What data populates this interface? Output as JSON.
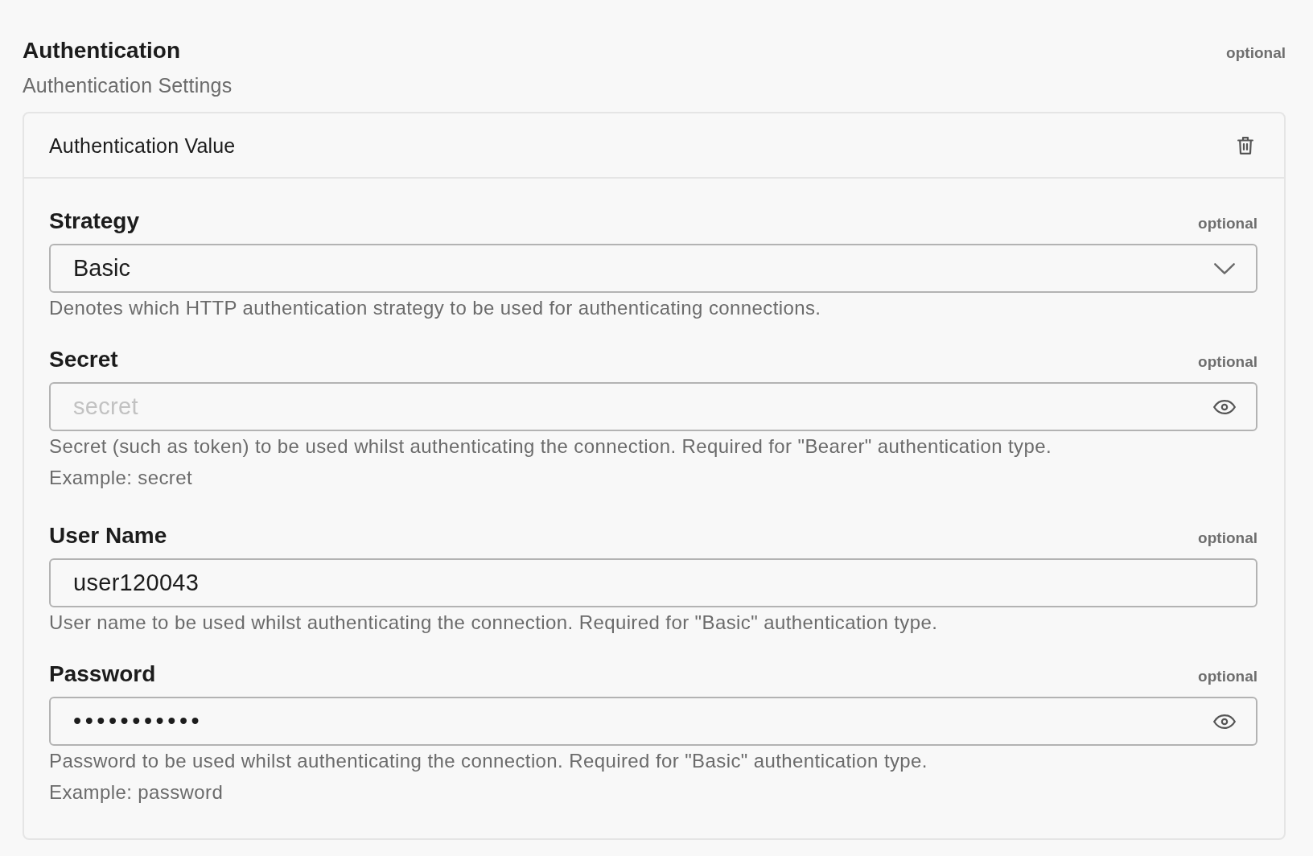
{
  "section": {
    "title": "Authentication",
    "badge": "optional",
    "subtitle": "Authentication Settings"
  },
  "card": {
    "title": "Authentication Value",
    "fields": [
      {
        "kind": "select",
        "label": "Strategy",
        "badge": "optional",
        "value": "Basic",
        "help": "Denotes which HTTP authentication strategy to be used for authenticating connections."
      },
      {
        "kind": "masked",
        "label": "Secret",
        "badge": "optional",
        "placeholder": "secret",
        "help": "Secret (such as token) to be used whilst authenticating the connection. Required for \"Bearer\" authentication type.",
        "example": "Example: secret"
      },
      {
        "kind": "text",
        "label": "User Name",
        "badge": "optional",
        "value": "user120043",
        "help": "User name to be used whilst authenticating the connection. Required for \"Basic\" authentication type."
      },
      {
        "kind": "masked",
        "label": "Password",
        "badge": "optional",
        "value": "•••••••••••",
        "help": "Password to be used whilst authenticating the connection. Required for \"Basic\" authentication type.",
        "example": "Example: password"
      }
    ]
  }
}
